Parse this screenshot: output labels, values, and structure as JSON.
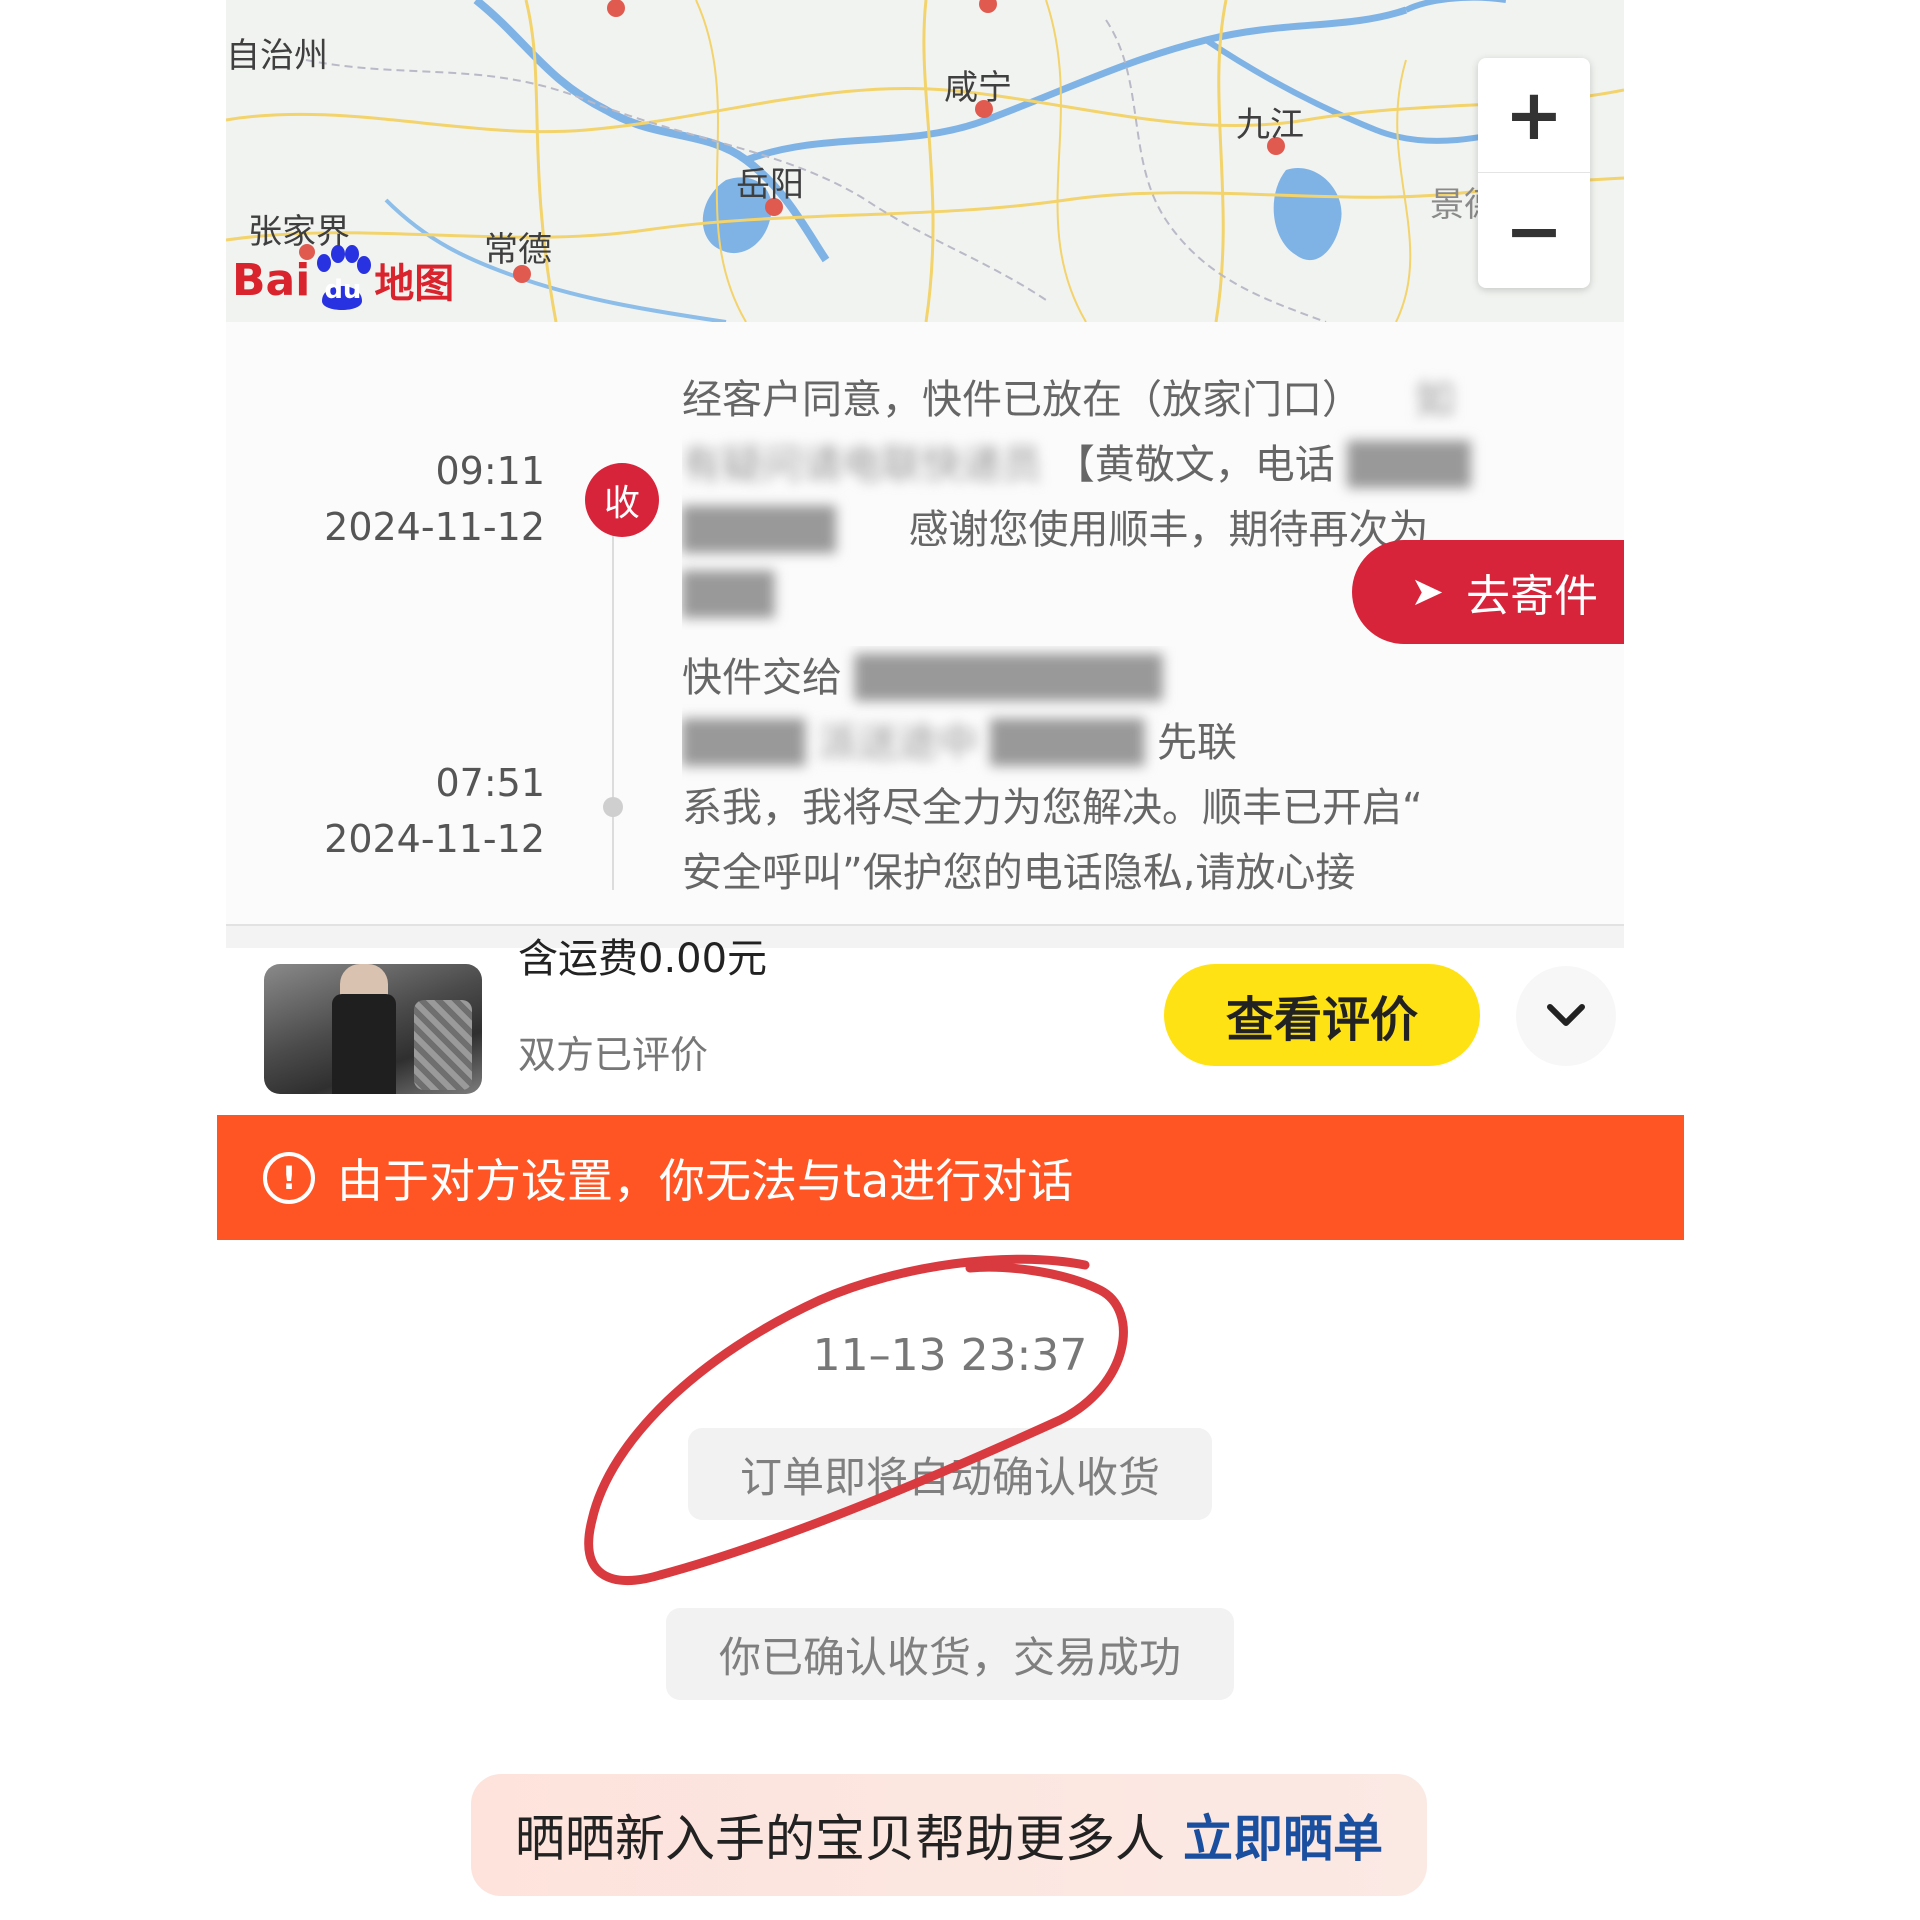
{
  "map": {
    "labels": {
      "zizhizhou": "自治州",
      "xianning": "咸宁",
      "jiujiang": "九江",
      "yueyang": "岳阳",
      "jingdezhen": "景德镇",
      "zhangjiajie": "张家界",
      "changde": "常德"
    },
    "zoom_in": "+",
    "zoom_out": "−",
    "logo_bai": "Bai",
    "logo_du": "du",
    "logo_map": "地图"
  },
  "tracking": {
    "events": [
      {
        "time": "09:11",
        "date": "2024-11-12",
        "badge": "收",
        "text_visible": "经客户同意，快件已放在（放家门口）",
        "text_visible_2": "如",
        "text_line2_blur": "有疑问请电联快递员",
        "text_line2": "【黄敬文，电话",
        "text_line3": "感谢您使用顺丰，期待再次为"
      },
      {
        "time": "07:51",
        "date": "2024-11-12",
        "text_line1": "快件交给",
        "text_line2": "派送途中",
        "text_line2_b": "先联",
        "text_line3": "系我，我将尽全力为您解决。顺丰已开启“",
        "text_line4": "安全呼叫”保护您的电话隐私,请放心接"
      }
    ],
    "send_button": "去寄件"
  },
  "order": {
    "freight": "含运费0.00元",
    "status": "双方已评价",
    "review_button": "查看评价"
  },
  "warning": {
    "icon": "!",
    "text": "由于对方设置，你无法与ta进行对话"
  },
  "chat": {
    "timestamp": "11–13 23:37",
    "msg_auto_confirm": "订单即将自动确认收货",
    "msg_confirmed": "你已确认收货，交易成功"
  },
  "share": {
    "text": "晒晒新入手的宝贝帮助更多人",
    "link": "立即晒单"
  },
  "colors": {
    "accent_red": "#d7243a",
    "warning_orange": "#ff5524",
    "review_yellow": "#ffe213",
    "link_blue": "#1a4fa0",
    "annotation_red": "#d93a3f"
  }
}
